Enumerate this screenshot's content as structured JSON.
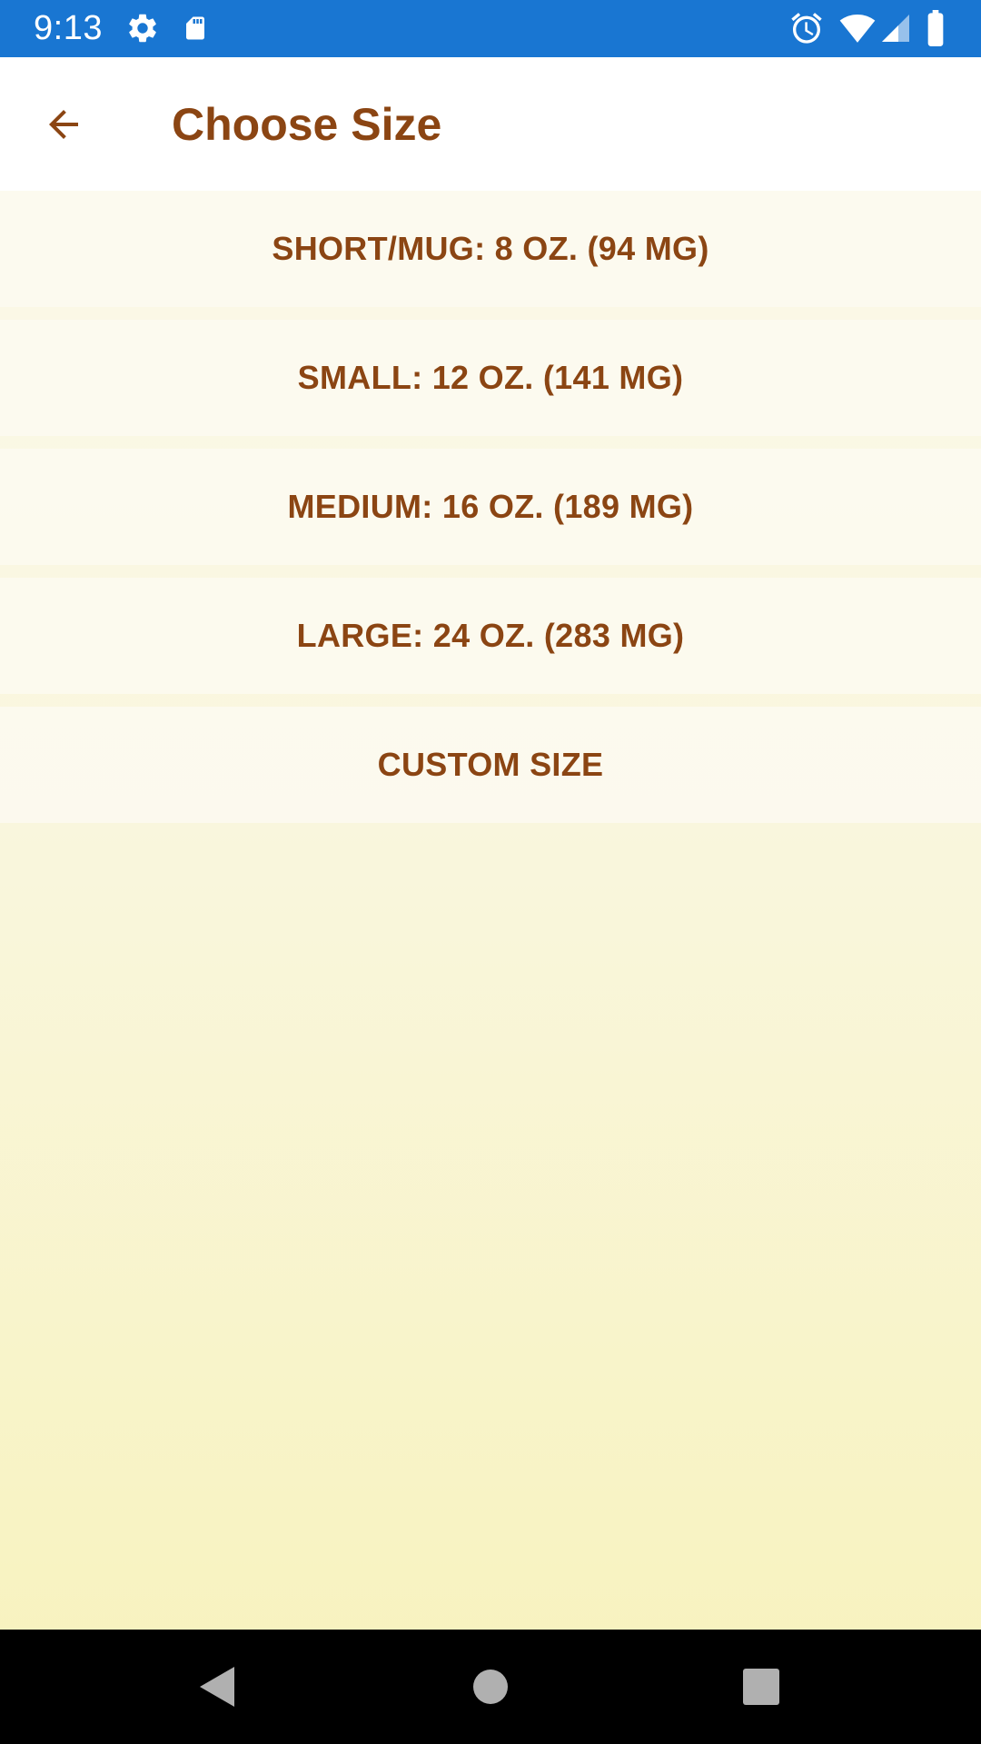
{
  "status_bar": {
    "time": "9:13",
    "icons": [
      "settings-icon",
      "sd-card-icon",
      "alarm-icon",
      "wifi-icon",
      "cell-signal-icon",
      "battery-icon"
    ],
    "background_color": "#1976d2"
  },
  "app_bar": {
    "title": "Choose Size",
    "back_icon": "arrow-back-icon",
    "accent_color": "#8b4513"
  },
  "sizes": [
    {
      "label": "SHORT/MUG: 8 OZ. (94 MG)"
    },
    {
      "label": "SMALL: 12 OZ. (141 MG)"
    },
    {
      "label": "MEDIUM: 16 OZ. (189 MG)"
    },
    {
      "label": "LARGE: 24 OZ. (283 MG)"
    },
    {
      "label": "CUSTOM SIZE"
    }
  ],
  "nav_bar": {
    "icons": [
      "back-triangle-icon",
      "home-circle-icon",
      "recents-square-icon"
    ]
  }
}
